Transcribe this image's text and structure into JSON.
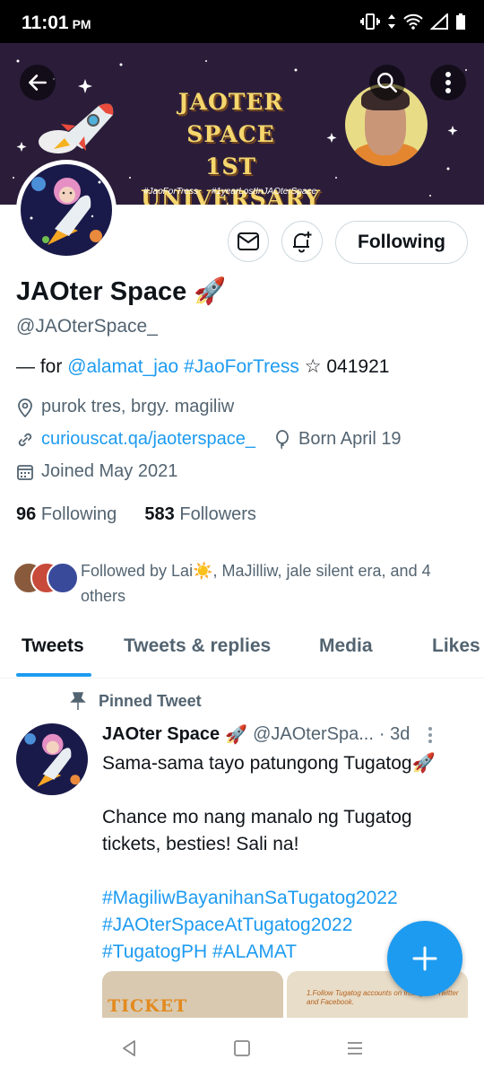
{
  "status_bar": {
    "time": "11:01",
    "ampm": "PM"
  },
  "banner": {
    "title_line1": "JAOTER SPACE",
    "title_line2": "1ST UNIVERSARY",
    "hashtag1": "#JaoForTress",
    "hashtag2": "#1yearLostInJAOterSpace"
  },
  "actions": {
    "follow_label": "Following"
  },
  "profile": {
    "name": "JAOter Space",
    "emoji": "🚀",
    "handle": "@JAOterSpace_",
    "bio_prefix": "— for ",
    "bio_mention": "@alamat_jao",
    "bio_tag": "#JaoForTress",
    "bio_suffix": "☆ 041921",
    "location": "purok tres, brgy. magiliw",
    "url": "curiouscat.qa/jaoterspace_",
    "birthday": "Born April 19",
    "joined": "Joined May 2021",
    "following_count": "96",
    "following_label": "Following",
    "followers_count": "583",
    "followers_label": "Followers",
    "followed_by": "Followed by Lai☀️, MaJilliw, jale silent era, and 4 others"
  },
  "tabs": [
    "Tweets",
    "Tweets & replies",
    "Media",
    "Likes"
  ],
  "pinned_label": "Pinned Tweet",
  "tweet": {
    "name": "JAOter Space",
    "emoji": "🚀",
    "handle": "@JAOterSpa...",
    "time": "· 3d",
    "line1": "Sama-sama tayo patungong Tugatog🚀",
    "line2": "Chance mo nang manalo ng Tugatog tickets, besties! Sali na!",
    "tag1": "#MagiliwBayanihanSaTugatog2022",
    "tag2": "#JAOterSpaceAtTugatog2022",
    "tag3": "#TugatogPH #ALAMAT",
    "media1_text": "TICKET GIVEAWAY",
    "media2_text": "1.Follow Tugatog accounts on Instagram Twitter and Facebook."
  },
  "colors": {
    "accent": "#1d9bf0",
    "banner_bg": "#2b1d3a",
    "title_yellow": "#f5d76e"
  }
}
